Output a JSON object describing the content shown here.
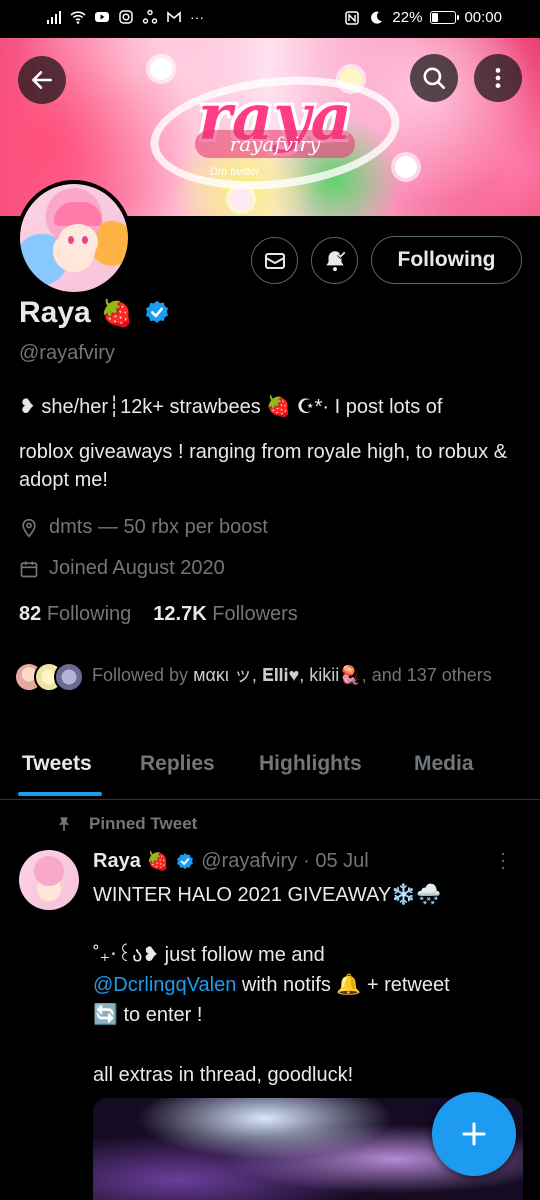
{
  "status_bar": {
    "battery": "22%",
    "time": "00:00",
    "left_icons": [
      "signal-icon",
      "wifi-icon",
      "youtube-icon",
      "instagram-icon",
      "share-icon",
      "gmail-icon",
      "more-notifications-icon"
    ],
    "right_icons": [
      "nfc-icon",
      "moon-icon",
      "battery-icon"
    ]
  },
  "banner": {
    "title": "raya",
    "subtitle": "rayafviry",
    "tag": "Dm twitter"
  },
  "profile": {
    "name": "Raya",
    "name_emoji": "🍓",
    "handle": "@rayafviry",
    "follow_label": "Following",
    "bio_line1": "❥ she/her┆12k+ strawbees 🍓 ☪*· I post lots of",
    "bio_line2": "roblox giveaways ! ranging from royale high, to robux & adopt me!",
    "location": "dmts — 50 rbx per boost",
    "joined": "Joined August 2020",
    "following_count": "82",
    "following_label": "Following",
    "followers_count": "12.7K",
    "followers_label": "Followers",
    "followed_by_prefix": "Followed by",
    "followed_by_names": "мακι ッ, 𝐄𝐥𝐥𝐢♥, kikii🪼",
    "followed_by_suffix": ", and 137 others"
  },
  "tabs": [
    {
      "label": "Tweets",
      "active": true
    },
    {
      "label": "Replies",
      "active": false
    },
    {
      "label": "Highlights",
      "active": false
    },
    {
      "label": "Media",
      "active": false
    }
  ],
  "pinned_tweet": {
    "pinned_label": "Pinned Tweet",
    "author_name": "Raya",
    "author_emoji": "🍓",
    "author_handle": "@rayafviry",
    "date": "· 05 Jul",
    "line1": "WINTER HALO 2021 GIVEAWAY❄️🌨️",
    "line2_prefix": "˚₊‧꒰ა❥ just follow me and",
    "mention": "@DcrlingqValen",
    "line3_suffix": " with notifs 🔔 + retweet",
    "line4": "🔄 to enter !",
    "line5": "all extras in thread, goodluck!"
  },
  "colors": {
    "accent": "#1d9bf0",
    "text_primary": "#e7e9ea",
    "text_secondary": "#71767b",
    "border": "#2f3336",
    "background": "#000000"
  }
}
